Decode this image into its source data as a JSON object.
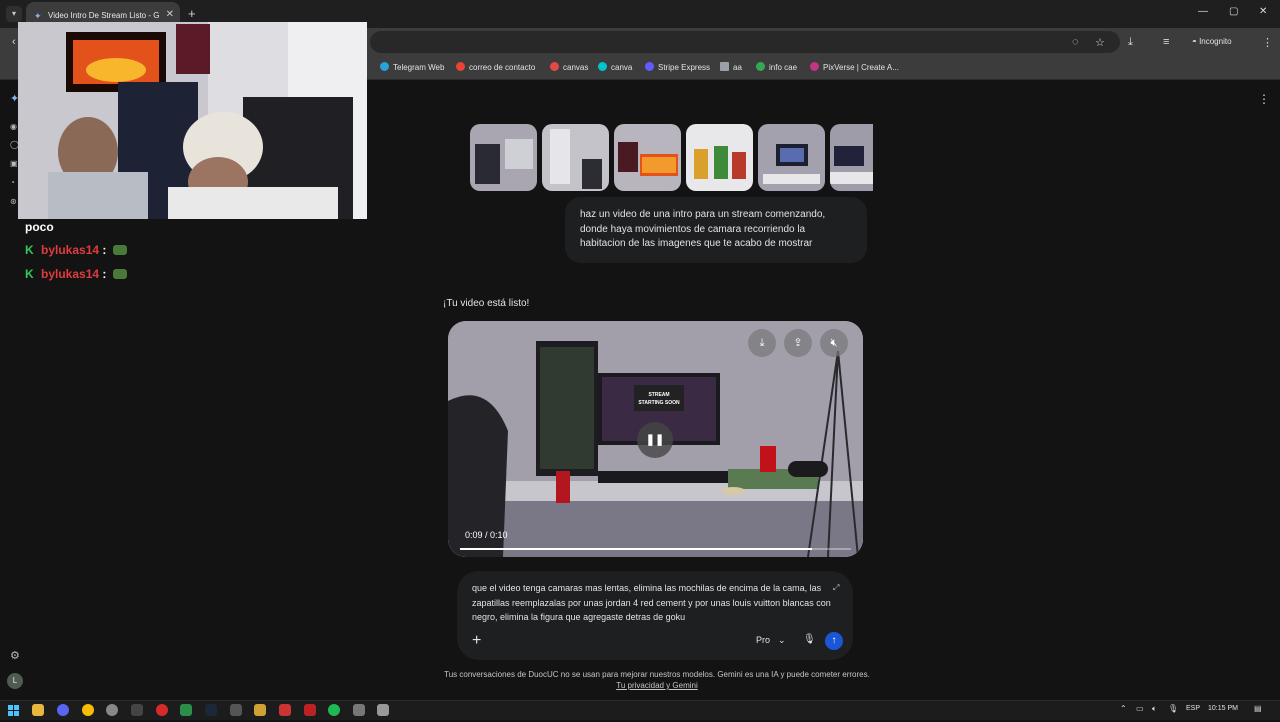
{
  "browser": {
    "tab_title": "Video Intro De Stream Listo - G",
    "new_tab": "+",
    "incognito_label": "Incognito",
    "window_controls": [
      "—",
      "▢",
      "✕"
    ],
    "bookmarks": [
      {
        "label": "Telegram Web",
        "color": "#2aa1da"
      },
      {
        "label": "correo de contacto",
        "color": "#ea4335"
      },
      {
        "label": "canvas",
        "color": "#e24a4a"
      },
      {
        "label": "canva",
        "color": "#00c4cc"
      },
      {
        "label": "Stripe Express",
        "color": "#635bff"
      },
      {
        "label": "aa",
        "color": "#9aa0a6"
      },
      {
        "label": "info cae",
        "color": "#34a853"
      },
      {
        "label": "PixVerse | Create A...",
        "color": "#c13584"
      }
    ]
  },
  "chat": {
    "lines": [
      {
        "text": "poco",
        "color": "#ffffff"
      },
      {
        "user": "bylukas14",
        "sep": ":",
        "color": "#e03c3c"
      },
      {
        "user": "bylukas14",
        "sep": ":",
        "color": "#e03c3c"
      }
    ],
    "badge": "K"
  },
  "conversation": {
    "user_prompt": "haz un video de una intro para un stream comenzando, donde haya movimientos de camara recorriendo la habitacion de las imagenes que te acabo de mostrar",
    "response_title": "¡Tu video está listo!",
    "video": {
      "time": "0:09 / 0:10",
      "progress": 0.9,
      "screen_text": "STREAM STARTING SOON",
      "icons": [
        "download-icon",
        "share-icon",
        "mute-icon"
      ]
    }
  },
  "composer": {
    "value": "que el video tenga camaras mas lentas, elimina las mochilas de encima de la cama, las zapatillas reemplazalas por unas jordan 4 red cement y por unas louis vuitton blancas con negro, elimina la figura que agregaste detras de goku",
    "model": "Pro"
  },
  "footer": {
    "disclaimer": "Tus conversaciones de DuocUC no se usan para mejorar nuestros modelos. Gemini es una IA y puede cometer errores.",
    "privacy_link": "Tu privacidad y Gemini"
  },
  "sidebar": {
    "avatar_letter": "L"
  },
  "taskbar": {
    "language": "ESP",
    "time": "10:15 PM"
  }
}
